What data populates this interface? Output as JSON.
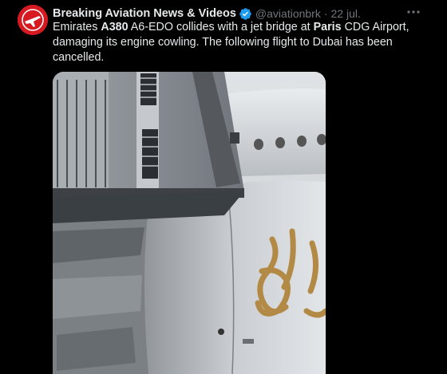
{
  "account": {
    "display_name": "Breaking Aviation News & Videos",
    "handle": "@aviationbrk",
    "separator": "·",
    "time": "22 jul."
  },
  "tweet": {
    "seg1": "Emirates ",
    "seg2": "A380",
    "seg3": " A6-EDO collides with a jet bridge at ",
    "seg4": "Paris",
    "seg5": " CDG Airport, damaging its engine cowling. The following flight to Dubai has been cancelled."
  },
  "icons": {
    "avatar": "plane-logo-icon",
    "verified": "verified-badge-icon",
    "more": "more-options-icon"
  },
  "colors": {
    "verified": "#1d9bf0",
    "avatar_bg": "#d71921",
    "muted": "#71767b"
  }
}
